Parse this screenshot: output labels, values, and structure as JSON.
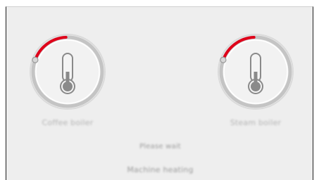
{
  "boilers": {
    "coffee": {
      "label": "Coffee boiler",
      "progress": 0.17
    },
    "steam": {
      "label": "Steam boiler",
      "progress": 0.17
    }
  },
  "status": {
    "line1": "Please wait",
    "line2": "Machine heating"
  },
  "colors": {
    "background": "#eeeeee",
    "ring": "#c4c4c4",
    "progress": "#e0001a",
    "thermometer": "#8a8a8a"
  },
  "icons": {
    "coffee": "thermometer-icon",
    "steam": "thermometer-icon"
  }
}
